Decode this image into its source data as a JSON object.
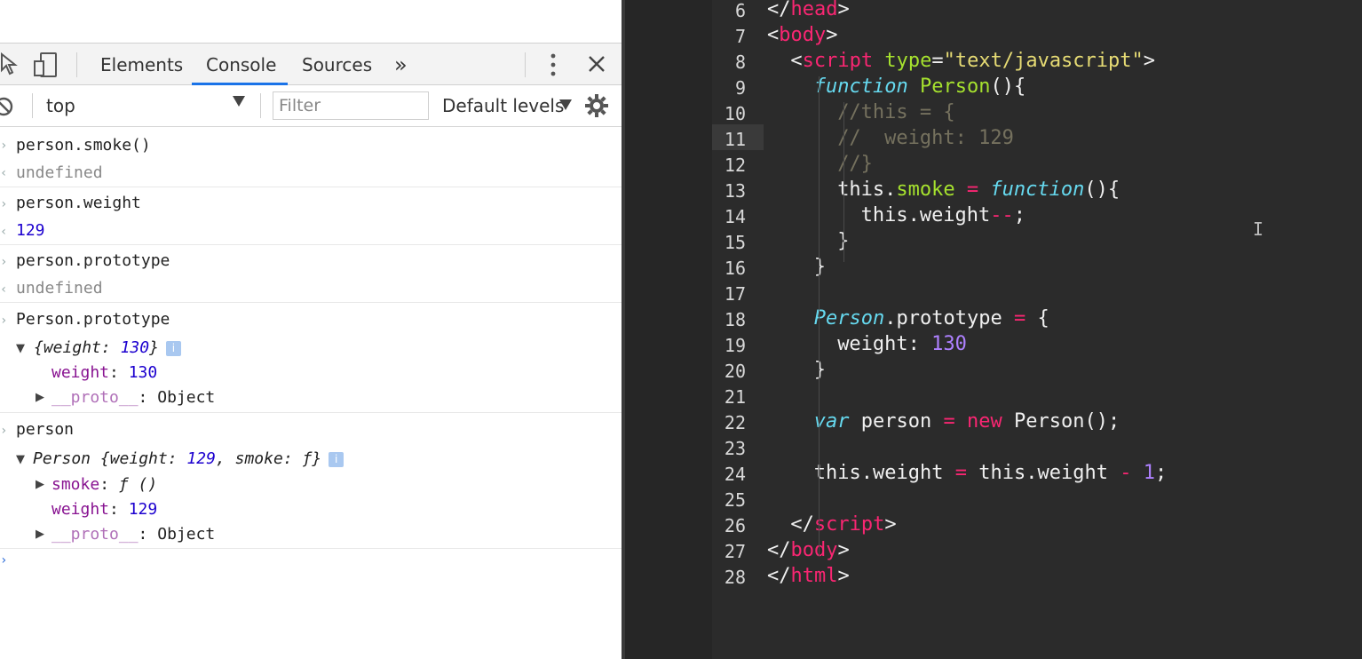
{
  "devtools": {
    "tabs": [
      "Elements",
      "Console",
      "Sources"
    ],
    "active_tab": "Console",
    "more_tabs": "»",
    "context": "top",
    "filter_placeholder": "Filter",
    "levels": "Default levels",
    "log": [
      {
        "input": "person.smoke()",
        "output": "undefined"
      },
      {
        "input": "person.weight",
        "output": "129"
      },
      {
        "input": "person.prototype",
        "output": "undefined"
      },
      {
        "input": "Person.prototype",
        "summary_pre": "{",
        "summary_key": "weight",
        "summary_sep": ": ",
        "summary_val": "130",
        "summary_post": "}",
        "props": [
          {
            "key": "weight",
            "sep": ": ",
            "value": "130"
          },
          {
            "key": "__proto__",
            "sep": ": ",
            "value": "Object"
          }
        ]
      },
      {
        "input": "person",
        "summary_pre": "Person {",
        "summary_key": "weight",
        "summary_sep": ": ",
        "summary_val": "129",
        "summary_sep2": ", ",
        "summary_key2": "smoke",
        "summary_val2": "ƒ",
        "summary_post": "}",
        "props": [
          {
            "key": "smoke",
            "sep": ": ",
            "value": "ƒ ()"
          },
          {
            "key": "weight",
            "sep": ": ",
            "value": "129"
          },
          {
            "key": "__proto__",
            "sep": ": ",
            "value": "Object"
          }
        ]
      }
    ],
    "info_badge": "i"
  },
  "editor": {
    "line_numbers": [
      "6",
      "7",
      "8",
      "9",
      "10",
      "11",
      "12",
      "13",
      "14",
      "15",
      "16",
      "17",
      "18",
      "19",
      "20",
      "21",
      "22",
      "23",
      "24",
      "25",
      "26",
      "27",
      "28"
    ],
    "current_line": "11",
    "lines": [
      [
        "</",
        "head",
        ">"
      ],
      [
        "<",
        "body",
        ">"
      ],
      [
        "<",
        "script",
        " ",
        "type",
        "=",
        "\"text/javascript\"",
        ">"
      ],
      [
        "function",
        " ",
        "Person",
        "(){"
      ],
      [
        "//this = {"
      ],
      [
        "//  weight: 129"
      ],
      [
        "//}"
      ],
      [
        "this.",
        "smoke",
        " ",
        "=",
        " ",
        "function",
        "(){"
      ],
      [
        "this.weight",
        "--",
        ";"
      ],
      [
        "}"
      ],
      [
        "}"
      ],
      [
        ""
      ],
      [
        "Person",
        ".prototype",
        " ",
        "=",
        " {"
      ],
      [
        "weight: ",
        "130"
      ],
      [
        "}"
      ],
      [
        ""
      ],
      [
        "var",
        " person ",
        "=",
        " ",
        "new",
        " Person();"
      ],
      [
        ""
      ],
      [
        "this.weight ",
        "=",
        " this.weight ",
        "-",
        " ",
        "1",
        ";"
      ],
      [
        ""
      ],
      [
        "</",
        "script",
        ">"
      ],
      [
        "</",
        "body",
        ">"
      ],
      [
        "</",
        "html",
        ">"
      ]
    ],
    "cursor_glyph": "I"
  },
  "colors": {
    "accent": "#1a73e8",
    "editor_bg": "#2b2b2b",
    "tag": "#f92672",
    "attr": "#a6e22e",
    "string": "#e6db74",
    "keyword": "#66d9ef",
    "number": "#ae81ff",
    "comment": "#75715e"
  }
}
